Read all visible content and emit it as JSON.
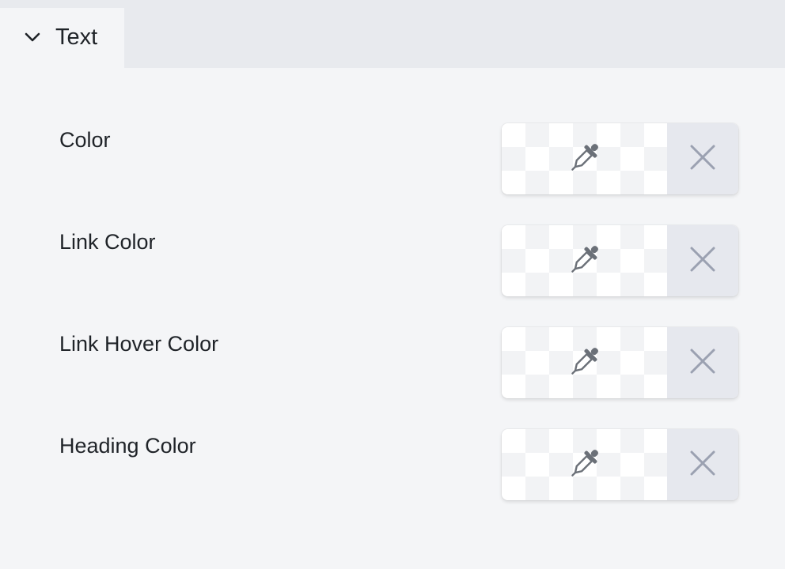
{
  "panel": {
    "tab": {
      "label": "Text",
      "icon": "chevron-down-icon"
    },
    "settings": [
      {
        "label": "Color"
      },
      {
        "label": "Link Color"
      },
      {
        "label": "Link Hover Color"
      },
      {
        "label": "Heading Color"
      }
    ]
  },
  "icons": {
    "picker": "eyedropper-icon",
    "clear": "close-icon"
  },
  "colors": {
    "background": "#f4f5f7",
    "header_bg": "#e8eaee",
    "clear_button_bg": "#e6e8ee",
    "eyedropper": "#6b7078",
    "clear_icon": "#9ba1b1"
  }
}
